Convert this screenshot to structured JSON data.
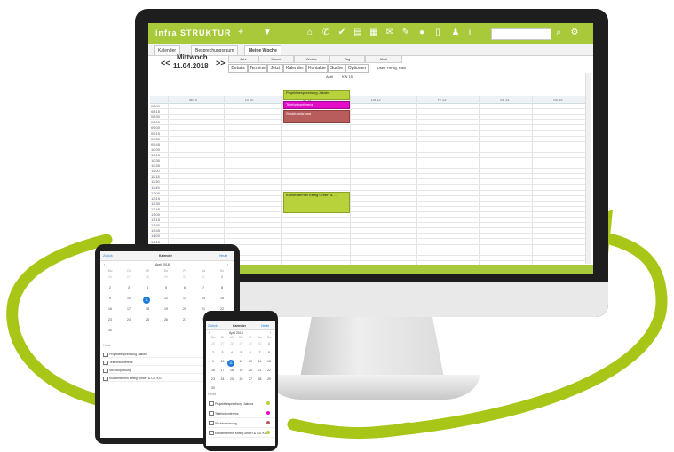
{
  "app": {
    "logo": "infra STRUKTUR"
  },
  "tabs": [
    "Kalender",
    "Besprechungsraum",
    "Meine Woche"
  ],
  "toolbar": {
    "prev": "<<",
    "next": ">>",
    "day": "Mittwoch",
    "date": "11.04.2018",
    "views": [
      "Jahr",
      "Monat",
      "Woche",
      "Tag",
      "Multi"
    ],
    "actions": [
      "Details",
      "Termine",
      "Jetzt",
      "Kalender",
      "Kontakte",
      "Suche",
      "Optionen"
    ],
    "user": "User: Fehlig, Paul"
  },
  "grid": {
    "header": "April",
    "week": "KW 15",
    "columns": [
      "Mo 9",
      "Di 10",
      "Mi 11",
      "Do 12",
      "Fr 13",
      "Sa 14",
      "So 15"
    ],
    "times": [
      "08:00",
      "08:15",
      "08:30",
      "08:45",
      "09:00",
      "09:15",
      "09:30",
      "09:45",
      "10:00",
      "10:15",
      "10:30",
      "10:45",
      "11:00",
      "11:15",
      "11:30",
      "11:45",
      "12:00",
      "12:15",
      "12:30",
      "12:45",
      "13:00",
      "13:15",
      "13:30",
      "13:45",
      "14:00",
      "14:15",
      "14:30",
      "14:45",
      "15:00",
      "15:15"
    ]
  },
  "events": [
    {
      "label": "Projektbesprechung Jakobs",
      "color": "#b7d23a"
    },
    {
      "label": "Telefonkonferenz",
      "color": "#e20bc8"
    },
    {
      "label": "Strukturplanung",
      "color": "#b85c5c"
    },
    {
      "label": "Kundentermin Kettig GmbH & ...",
      "color": "#b7d23a"
    }
  ],
  "tablet": {
    "back": "Zurück",
    "title": "Kalender",
    "action": "Heute",
    "month": "April 2018",
    "weekdays": [
      "Mo",
      "Di",
      "Mi",
      "Do",
      "Fr",
      "Sa",
      "So"
    ],
    "days": [
      "26",
      "27",
      "28",
      "29",
      "30",
      "31",
      "1",
      "2",
      "3",
      "4",
      "5",
      "6",
      "7",
      "8",
      "9",
      "10",
      "11",
      "12",
      "13",
      "14",
      "15",
      "16",
      "17",
      "18",
      "19",
      "20",
      "21",
      "22",
      "23",
      "24",
      "25",
      "26",
      "27",
      "28",
      "29",
      "30"
    ],
    "selected": "11",
    "list_header": "Heute",
    "list": [
      "Projektbesprechung Jakobs",
      "Telefonkonferenz",
      "Strukturplanung",
      "Kundentermin Kettig GmbH & Co. KG"
    ]
  },
  "phone": {
    "back": "Zurück",
    "title": "Kalender",
    "action": "Heute",
    "month": "April 2018",
    "weekdays": [
      "Mo",
      "Di",
      "Mi",
      "Do",
      "Fr",
      "Sa",
      "So"
    ],
    "days": [
      "26",
      "27",
      "28",
      "29",
      "30",
      "31",
      "1",
      "2",
      "3",
      "4",
      "5",
      "6",
      "7",
      "8",
      "9",
      "10",
      "11",
      "12",
      "13",
      "14",
      "15",
      "16",
      "17",
      "18",
      "19",
      "20",
      "21",
      "22",
      "23",
      "24",
      "25",
      "26",
      "27",
      "28",
      "29",
      "30"
    ],
    "selected": "11",
    "list_header": "Heute",
    "list": [
      "Projektbesprechung Jakobs",
      "Telefonkonferenz",
      "Strukturplanung",
      "Kundentermin Kettig GmbH & Co. KG"
    ],
    "dot_colors": [
      "#b7d23a",
      "#e20bc8",
      "#b85c5c",
      "#b7d23a"
    ]
  },
  "colors": {
    "brand": "#a8c93a",
    "arrow": "#a8c618",
    "selected": "#1e7bd8"
  }
}
